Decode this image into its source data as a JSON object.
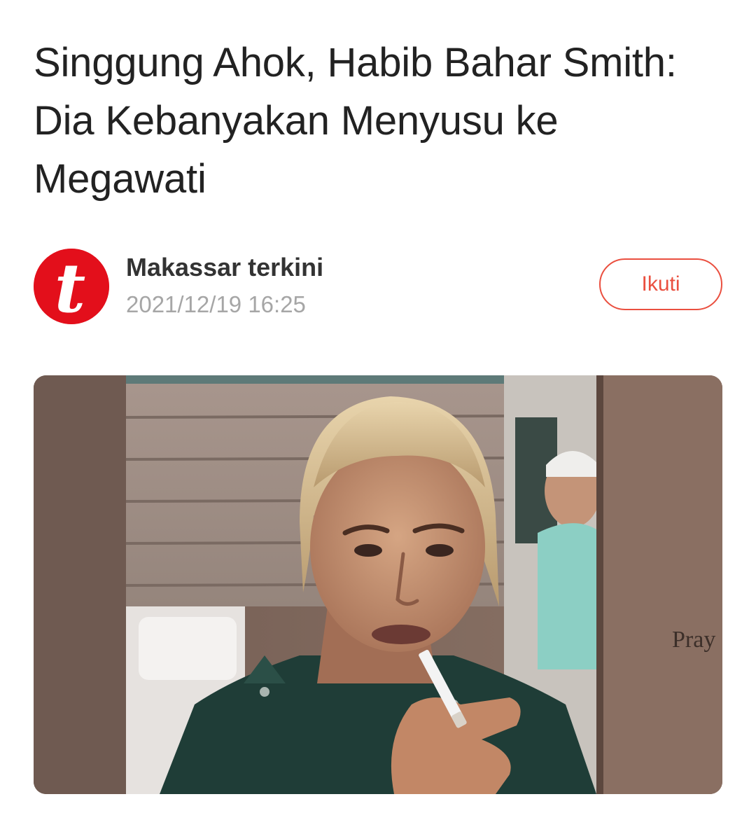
{
  "article": {
    "title": "Singgung Ahok, Habib Bahar Smith: Dia Kebanyakan Menyusu ke Megawati"
  },
  "source": {
    "logo_letter": "t",
    "name": "Makassar terkini",
    "timestamp": "2021/12/19 16:25",
    "follow_label": "Ikuti"
  },
  "hero_image": {
    "sign_text": "Pray"
  },
  "colors": {
    "accent": "#ea4f3f",
    "logo_red": "#e30f1b",
    "title_text": "#222222",
    "muted_text": "#a6a6a6"
  }
}
